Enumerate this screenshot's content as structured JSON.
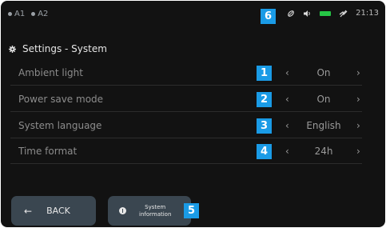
{
  "status_bar": {
    "indicators": [
      "A1",
      "A2"
    ],
    "time": "21:13",
    "icons": [
      "leaf-icon",
      "volume-icon",
      "battery-icon",
      "signal-off-icon"
    ],
    "battery_color": "#26c646"
  },
  "callouts": [
    "1",
    "2",
    "3",
    "4",
    "5",
    "6"
  ],
  "header": {
    "icon": "gear-icon",
    "title": "Settings - System"
  },
  "settings": [
    {
      "label": "Ambient light",
      "value": "On"
    },
    {
      "label": "Power save mode",
      "value": "On"
    },
    {
      "label": "System language",
      "value": "English"
    },
    {
      "label": "Time format",
      "value": "24h"
    }
  ],
  "arrows": {
    "left": "‹",
    "right": "›"
  },
  "buttons": {
    "back_label": "BACK",
    "back_arrow": "←",
    "info_label": "System\ninformation"
  },
  "colors": {
    "accent_badge": "#1a9be6",
    "button_bg": "#3a4650",
    "background": "#121212"
  }
}
